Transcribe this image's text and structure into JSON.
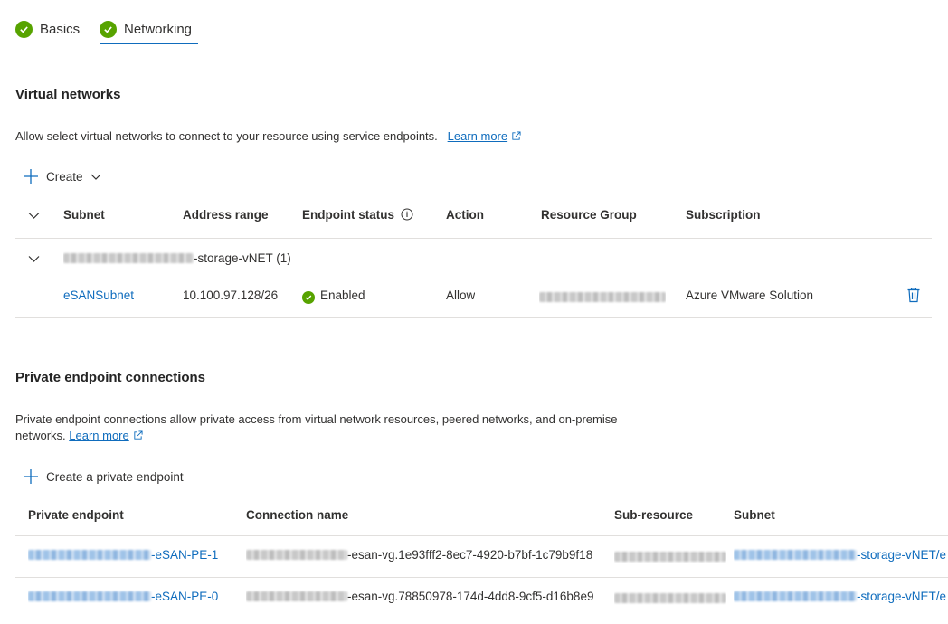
{
  "tabs": [
    {
      "label": "Basics"
    },
    {
      "label": "Networking"
    }
  ],
  "vnet": {
    "heading": "Virtual networks",
    "description": "Allow select virtual networks to connect to your resource using service endpoints.",
    "learn_more": "Learn more",
    "create_label": "Create",
    "columns": [
      "Subnet",
      "Address range",
      "Endpoint status",
      "Action",
      "Resource Group",
      "Subscription"
    ],
    "group_label_suffix": "-storage-vNET (1)",
    "rows": [
      {
        "subnet": "eSANSubnet",
        "address_range": "10.100.97.128/26",
        "status": "Enabled",
        "action": "Allow",
        "subscription": "Azure VMware Solution"
      }
    ]
  },
  "pe": {
    "heading": "Private endpoint connections",
    "description_line1": "Private endpoint connections allow private access from virtual network resources, peered networks, and on-premise",
    "description_line2": "networks.",
    "learn_more": "Learn more",
    "create_label": "Create a private endpoint",
    "columns": [
      "Private endpoint",
      "Connection name",
      "Sub-resource",
      "Subnet"
    ],
    "rows": [
      {
        "endpoint_suffix": "-eSAN-PE-1",
        "connection_suffix": "-esan-vg.1e93fff2-8ec7-4920-b7bf-1c79b9f18",
        "subnet_suffix": "-storage-vNET/e"
      },
      {
        "endpoint_suffix": "-eSAN-PE-0",
        "connection_suffix": "-esan-vg.78850978-174d-4dd8-9cf5-d16b8e9",
        "subnet_suffix": "-storage-vNET/e"
      }
    ]
  },
  "colors": {
    "accent": "#0f6cbd",
    "success": "#57a300",
    "divider": "#e1dfdd"
  }
}
